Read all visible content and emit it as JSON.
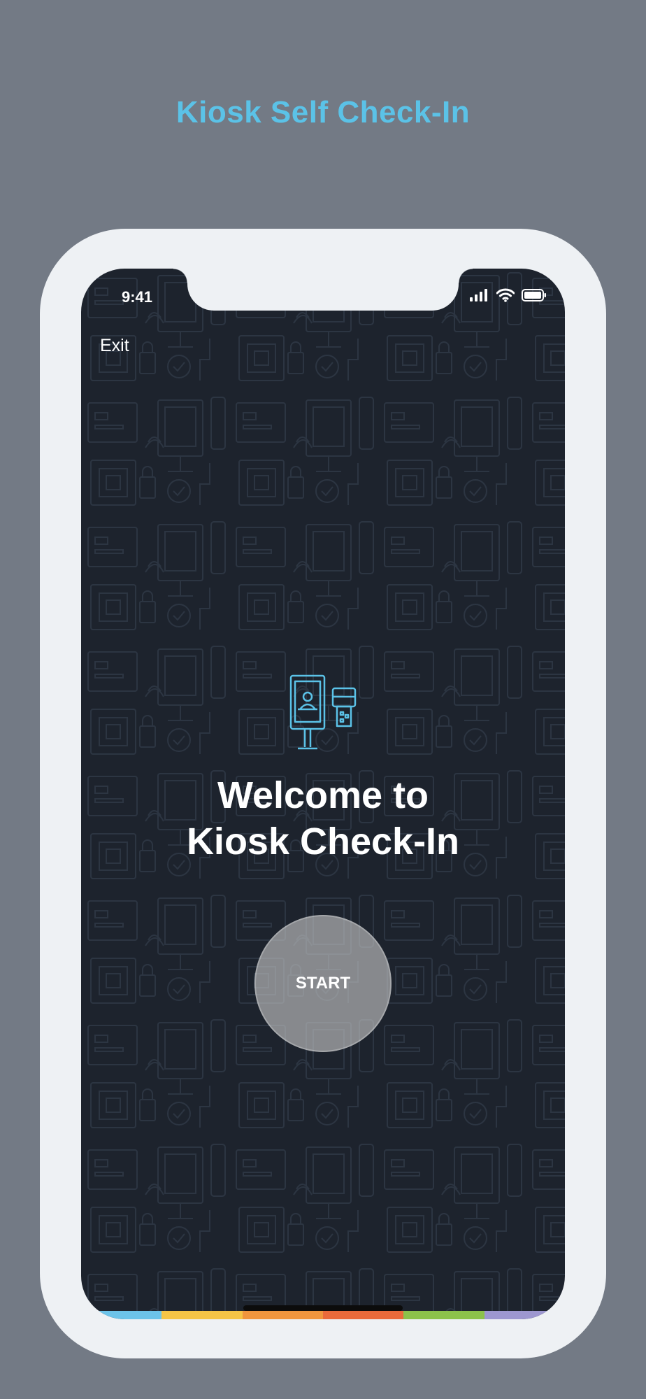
{
  "page": {
    "title": "Kiosk Self Check-In"
  },
  "status_bar": {
    "time": "9:41"
  },
  "nav": {
    "exit_label": "Exit"
  },
  "welcome": {
    "line1": "Welcome to",
    "line2": "Kiosk Check-In"
  },
  "start_button": {
    "label": "START"
  },
  "colors": {
    "background": "#737a85",
    "title": "#5bc2e7",
    "phone_frame": "#eef1f4",
    "screen": "#1d232d",
    "accent_blue": "#5bc2e7",
    "bar": [
      "#6cc3e9",
      "#f5c445",
      "#f0953d",
      "#ea6a3b",
      "#8cc24a",
      "#9d97d0"
    ]
  },
  "icons": {
    "signal": "cellular-signal-icon",
    "wifi": "wifi-icon",
    "battery": "battery-icon",
    "kiosk": "kiosk-terminal-icon",
    "card_reader": "card-reader-icon"
  }
}
